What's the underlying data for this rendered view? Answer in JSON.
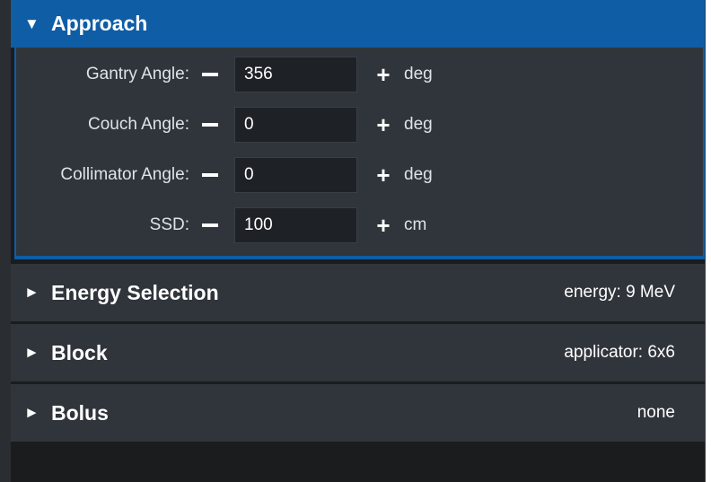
{
  "approach": {
    "title": "Approach",
    "expanded_arrow": "▼",
    "fields": [
      {
        "label": "Gantry Angle:",
        "value": "356",
        "unit": "deg"
      },
      {
        "label": "Couch Angle:",
        "value": "0",
        "unit": "deg"
      },
      {
        "label": "Collimator Angle:",
        "value": "0",
        "unit": "deg"
      },
      {
        "label": "SSD:",
        "value": "100",
        "unit": "cm"
      }
    ],
    "minus_symbol": "−",
    "plus_symbol": "+"
  },
  "sections": [
    {
      "title": "Energy Selection",
      "summary": "energy: 9 MeV",
      "arrow": "►"
    },
    {
      "title": "Block",
      "summary": "applicator: 6x6",
      "arrow": "►"
    },
    {
      "title": "Bolus",
      "summary": "none",
      "arrow": "►"
    }
  ],
  "colors": {
    "accent": "#0f5da5",
    "panel": "#30353b",
    "background": "#1b1c1e",
    "input": "#1e2125"
  }
}
